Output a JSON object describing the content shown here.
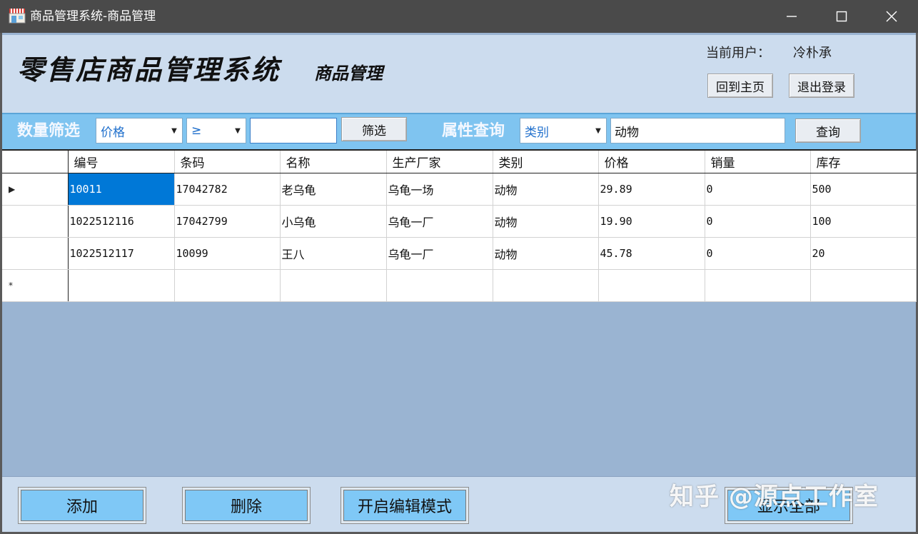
{
  "window": {
    "title": "商品管理系统-商品管理",
    "icon": "shop-icon"
  },
  "header": {
    "big_title": "零售店商品管理系统",
    "small_title": "商品管理",
    "user_label": "当前用户：",
    "user_name": "冷朴承",
    "home_button": "回到主页",
    "logout_button": "退出登录"
  },
  "filter": {
    "qty_label": "数量筛选",
    "field_value": "价格",
    "operator_value": "≥",
    "qty_input_value": "",
    "filter_button": "筛选",
    "attr_label": "属性查询",
    "type_value": "类别",
    "query_input_value": "动物",
    "query_button": "查询"
  },
  "grid": {
    "columns": [
      "编号",
      "条码",
      "名称",
      "生产厂家",
      "类别",
      "价格",
      "销量",
      "库存"
    ],
    "rows": [
      [
        "10011",
        "17042782",
        "老乌龟",
        "乌龟一场",
        "动物",
        "29.89",
        "0",
        "500"
      ],
      [
        "1022512116",
        "17042799",
        "小乌龟",
        "乌龟一厂",
        "动物",
        "19.90",
        "0",
        "100"
      ],
      [
        "1022512117",
        "10099",
        "王八",
        "乌龟一厂",
        "动物",
        "45.78",
        "0",
        "20"
      ]
    ],
    "current_row_marker": "▶",
    "new_row_marker": "*",
    "selection_color": "#0078d7"
  },
  "actions": {
    "add": "添加",
    "delete": "删除",
    "edit_mode": "开启编辑模式",
    "show_all": "显示全部"
  },
  "watermark": "知乎 @源点工作室",
  "colors": {
    "titlebar": "#4a4a4a",
    "header_bg": "#ccdcee",
    "filter_bg": "#7fc4f0",
    "body_bg": "#9ab4d2",
    "action_btn": "#7fc8f6"
  }
}
